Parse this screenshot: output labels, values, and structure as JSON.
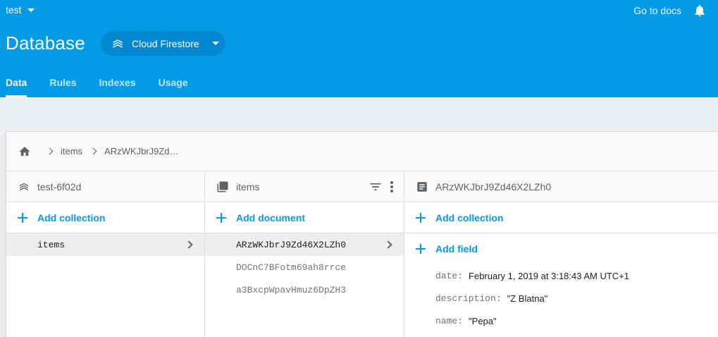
{
  "header": {
    "project": "test",
    "docs_link": "Go to docs",
    "title": "Database",
    "db_selector": "Cloud Firestore",
    "tabs": [
      {
        "label": "Data",
        "active": true
      },
      {
        "label": "Rules",
        "active": false
      },
      {
        "label": "Indexes",
        "active": false
      },
      {
        "label": "Usage",
        "active": false
      }
    ]
  },
  "colors": {
    "header": "#039be5",
    "accent": "#039be5",
    "selected_row": "#eeeeee"
  },
  "breadcrumb": {
    "home_icon": "home-icon",
    "items": [
      "items",
      "ARzWKJbrJ9Zd…"
    ]
  },
  "columns": {
    "root": {
      "title": "test-6f02d",
      "add_label": "Add collection",
      "items": [
        {
          "label": "items",
          "selected": true
        }
      ]
    },
    "collection": {
      "title": "items",
      "add_label": "Add document",
      "items": [
        {
          "label": "ARzWKJbrJ9Zd46X2LZh0",
          "selected": true
        },
        {
          "label": "DOCnC7BFotm69ah8rrce",
          "selected": false
        },
        {
          "label": "a3BxcpWpavHmuz6DpZH3",
          "selected": false
        }
      ]
    },
    "document": {
      "title": "ARzWKJbrJ9Zd46X2LZh0",
      "add_collection_label": "Add collection",
      "add_field_label": "Add field",
      "fields": [
        {
          "key": "date",
          "value": "February 1, 2019 at 3:18:43 AM UTC+1"
        },
        {
          "key": "description",
          "value": "\"Z Blatna\""
        },
        {
          "key": "name",
          "value": "\"Pepa\""
        }
      ]
    }
  }
}
